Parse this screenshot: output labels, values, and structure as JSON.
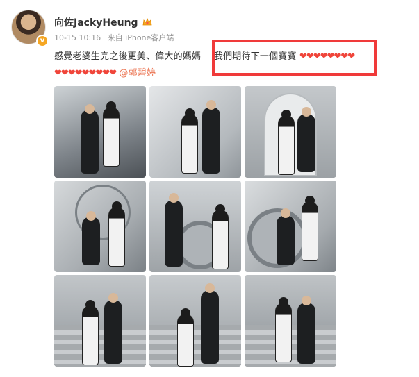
{
  "post": {
    "username": "向佐JackyHeung",
    "timestamp": "10-15 10:16",
    "source": "来自 iPhone客户端",
    "text_part1": "感覺老婆生完之後更美、偉大的媽媽",
    "text_part2": "我們期待下一個寶寶",
    "hearts_line1": "❤❤❤❤❤❤❤❤",
    "hearts_line2": "❤❤❤❤❤❤❤❤❤",
    "mention": "@郭碧婷"
  },
  "colors": {
    "accent": "#eb7350",
    "heart": "#f0453a",
    "highlight_border": "#f03a3a",
    "meta_gray": "#939393"
  },
  "icons": {
    "verified": "verified-badge-icon",
    "crown": "crown-icon"
  },
  "photos": [
    {
      "label": "photo-1"
    },
    {
      "label": "photo-2"
    },
    {
      "label": "photo-3"
    },
    {
      "label": "photo-4"
    },
    {
      "label": "photo-5"
    },
    {
      "label": "photo-6"
    },
    {
      "label": "photo-7"
    },
    {
      "label": "photo-8"
    },
    {
      "label": "photo-9"
    }
  ]
}
